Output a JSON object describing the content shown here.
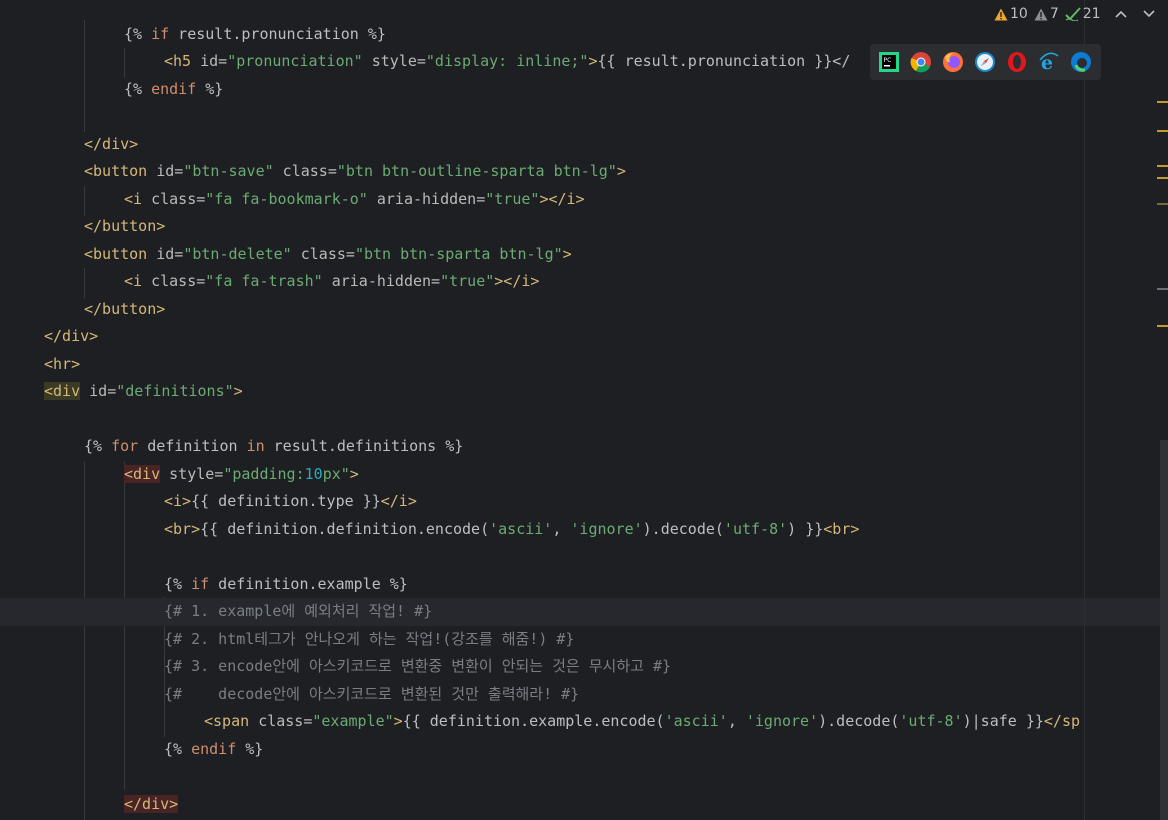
{
  "inspections": {
    "warnings": "10",
    "weak_warnings": "7",
    "typos": "21"
  },
  "browser_icons": [
    "pycharm-icon",
    "chrome-icon",
    "firefox-icon",
    "safari-icon",
    "opera-icon",
    "internet-explorer-icon",
    "edge-icon"
  ],
  "colors": {
    "background": "#1e1f22",
    "tag": "#d5b778",
    "string": "#6aab73",
    "keyword": "#cf8e6d",
    "comment": "#7a7e85",
    "number": "#2aacb8",
    "warning": "#f0a732"
  },
  "code": {
    "l1": {
      "open": "{% ",
      "kw": "if",
      "rest": " result.pronunciation %}"
    },
    "l2": {
      "tag": "<h5 ",
      "a1": "id=",
      "v1": "\"pronunciation\"",
      "a2": " style=",
      "v2": "\"display: inline;\"",
      "tag2": ">",
      "text": "{{ result.pronunciation }}</"
    },
    "l3": {
      "open": "{% ",
      "kw": "endif",
      "rest": " %}"
    },
    "l4": {
      "tag": "</div>"
    },
    "l5": {
      "tag": "<button ",
      "a1": "id=",
      "v1": "\"btn-save\"",
      "a2": " class=",
      "v2": "\"btn btn-outline-sparta btn-lg\"",
      "tag2": ">"
    },
    "l6": {
      "tag": "<i ",
      "a1": "class=",
      "v1": "\"fa fa-bookmark-o\"",
      "a2": " aria-hidden=",
      "v2": "\"true\"",
      "tag2": "></i>"
    },
    "l7": {
      "tag": "</button>"
    },
    "l8": {
      "tag": "<button ",
      "a1": "id=",
      "v1": "\"btn-delete\"",
      "a2": " class=",
      "v2": "\"btn btn-sparta btn-lg\"",
      "tag2": ">"
    },
    "l9": {
      "tag": "<i ",
      "a1": "class=",
      "v1": "\"fa fa-trash\"",
      "a2": " aria-hidden=",
      "v2": "\"true\"",
      "tag2": "></i>"
    },
    "l10": {
      "tag": "</button>"
    },
    "l11": {
      "tag": "</div>"
    },
    "l12": {
      "tag": "<hr>"
    },
    "l13": {
      "tag": "<div",
      "a1": " id=",
      "v1": "\"definitions\"",
      "tag2": ">"
    },
    "l14": {
      "open": "{% ",
      "kw": "for",
      "mid": " definition ",
      "kw2": "in",
      "rest": " result.definitions %}"
    },
    "l15": {
      "tag": "<div",
      "a1": " style=",
      "v1a": "\"padding:",
      "num": "10",
      "v1b": "px\"",
      "tag2": ">"
    },
    "l16": {
      "tag": "<i>",
      "text": "{{ definition.type }}",
      "tag2": "</i>"
    },
    "l17": {
      "tag": "<br>",
      "t1": "{{ definition.definition.encode(",
      "s1": "'ascii'",
      "t2": ", ",
      "s2": "'ignore'",
      "t3": ").decode(",
      "s3": "'utf-8'",
      "t4": ") }}",
      "tag2": "<br>"
    },
    "l18": {
      "open": "{% ",
      "kw": "if",
      "rest": " definition.example %}"
    },
    "l19": {
      "text": "{# 1. example에 예외처리 작업! #}"
    },
    "l20": {
      "text": "{# 2. html테그가 안나오게 하는 작업!(강조를 해줌!) #}"
    },
    "l21": {
      "text": "{# 3. encode안에 아스키코드로 변환중 변환이 안되는 것은 무시하고 #}"
    },
    "l22": {
      "text": "{#    decode안에 아스키코드로 변환된 것만 출력해라! #}"
    },
    "l23": {
      "tag": "<span ",
      "a1": "class=",
      "v1": "\"example\"",
      "tag2": ">",
      "t1": "{{ definition.example.encode(",
      "s1": "'ascii'",
      "t2": ", ",
      "s2": "'ignore'",
      "t3": ").decode(",
      "s3": "'utf-8'",
      "t4": ")|safe }}",
      "tag3": "</sp"
    },
    "l24": {
      "open": "{% ",
      "kw": "endif",
      "rest": " %}"
    },
    "l25": {
      "tag": "</div>"
    }
  }
}
